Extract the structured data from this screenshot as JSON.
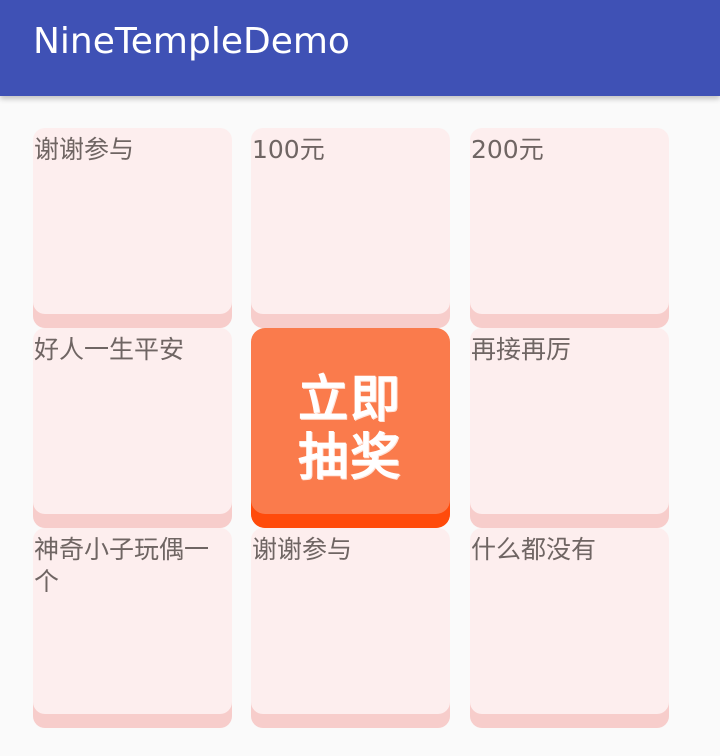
{
  "app_bar": {
    "title": "NineTempleDemo"
  },
  "lottery": {
    "cells": [
      {
        "label": "谢谢参与"
      },
      {
        "label": "100元"
      },
      {
        "label": "200元"
      },
      {
        "label": "好人一生平安"
      },
      {
        "label": "再接再厉"
      },
      {
        "label": "神奇小子玩偶一个"
      },
      {
        "label": "谢谢参与"
      },
      {
        "label": "什么都没有"
      }
    ],
    "draw_button": {
      "label": "立即抽奖"
    }
  },
  "colors": {
    "app_bar": "#3f51b5",
    "cell_background": "#fdeeee",
    "cell_bottom": "#f7cdcb",
    "draw_button": "#fa7b4c",
    "draw_button_bottom": "#ff4b0b"
  }
}
